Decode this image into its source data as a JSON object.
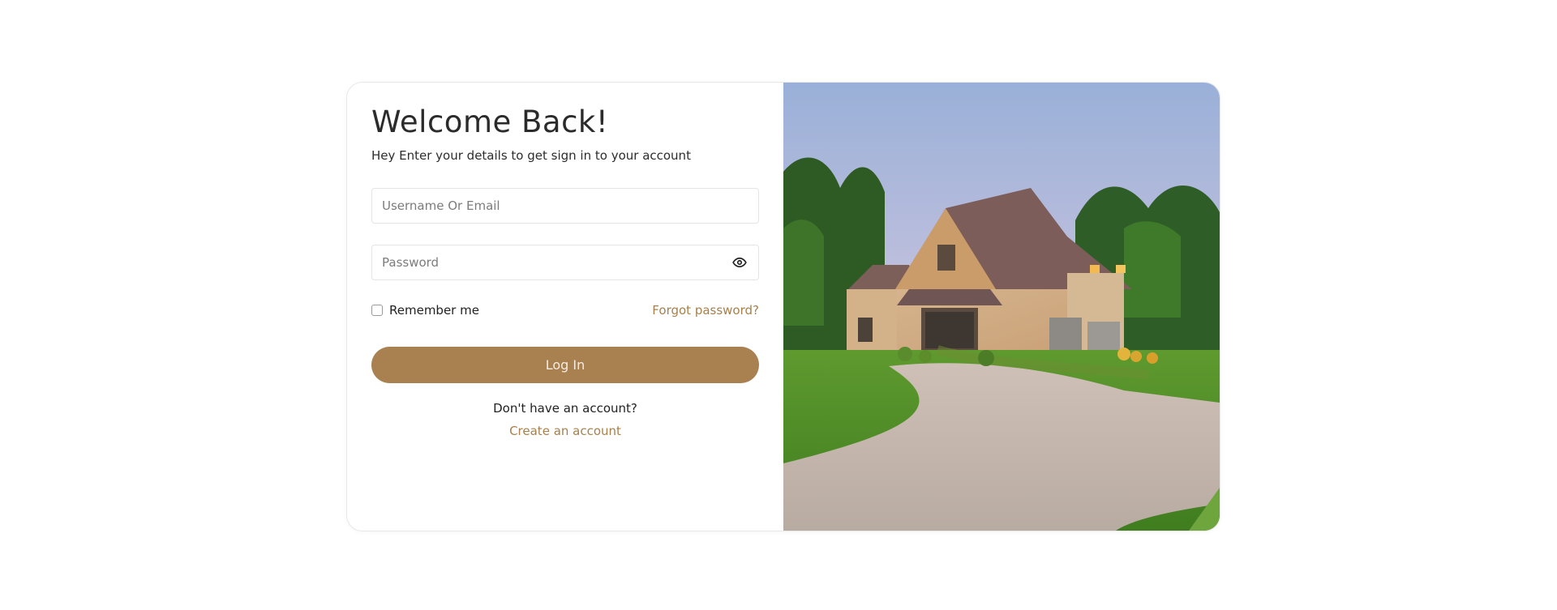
{
  "login": {
    "title": "Welcome Back!",
    "subtitle": "Hey Enter your details to get sign in to your account",
    "username_placeholder": "Username Or Email",
    "username_value": "",
    "password_placeholder": "Password",
    "password_value": "",
    "password_toggle_icon": "eye-icon",
    "remember_label": "Remember me",
    "remember_checked": false,
    "forgot_label": "Forgot password?",
    "login_label": "Log In",
    "no_account_text": "Don't have an account?",
    "create_account_label": "Create an account"
  },
  "colors": {
    "accent": "#a98050",
    "link": "#a8804a",
    "border": "#e4e4e4"
  }
}
